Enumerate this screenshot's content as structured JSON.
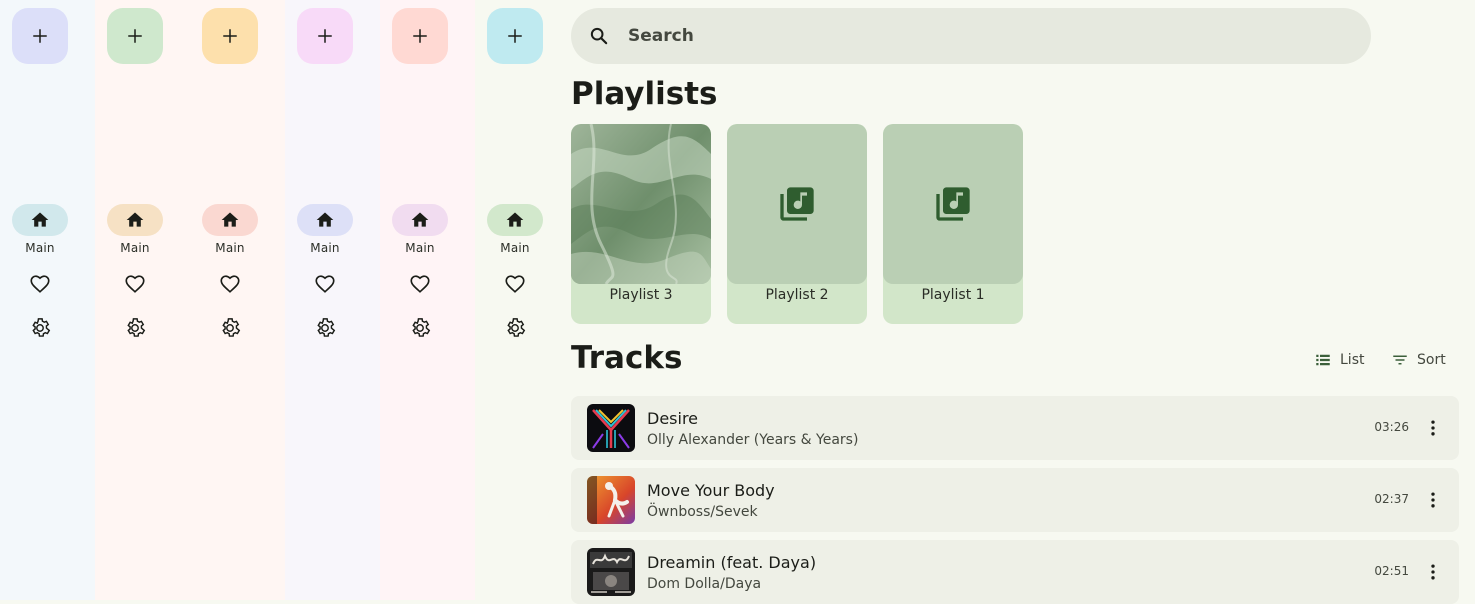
{
  "rails": [
    {
      "bg": "#f3f8fb",
      "fab": "#dcdff9",
      "pill": "#d1e8ec",
      "main_label": "Main"
    },
    {
      "bg": "#fff6f3",
      "fab": "#cfe8cd",
      "pill": "#f6e1c4",
      "main_label": "Main"
    },
    {
      "bg": "#fff6f3",
      "fab": "#fde0ac",
      "pill": "#fad8d1",
      "main_label": "Main"
    },
    {
      "bg": "#f8f6fb",
      "fab": "#f8daf8",
      "pill": "#dde0f7",
      "main_label": "Main"
    },
    {
      "bg": "#fff4f6",
      "fab": "#ffd9d3",
      "pill": "#f1dcf0",
      "main_label": "Main"
    },
    {
      "bg": "#f7f9f1",
      "fab": "#bfeaf0",
      "pill": "#d2e8cc",
      "main_label": "Main"
    }
  ],
  "search": {
    "placeholder": "Search"
  },
  "playlists": {
    "heading": "Playlists",
    "items": [
      {
        "label": "Playlist 3"
      },
      {
        "label": "Playlist 2"
      },
      {
        "label": "Playlist 1"
      }
    ]
  },
  "tracks": {
    "heading": "Tracks",
    "list_label": "List",
    "sort_label": "Sort",
    "items": [
      {
        "title": "Desire",
        "artist": "Olly Alexander (Years & Years)",
        "duration": "03:26"
      },
      {
        "title": "Move Your Body",
        "artist": "Öwnboss/Sevek",
        "duration": "02:37"
      },
      {
        "title": "Dreamin (feat. Daya)",
        "artist": "Dom Dolla/Daya",
        "duration": "02:51"
      }
    ]
  },
  "icons": {
    "fab": "add-icon",
    "nav_main": "home-icon",
    "nav_favorites": "heart-icon",
    "nav_settings": "gear-icon",
    "search": "search-icon",
    "playlist_placeholder": "library-music-icon",
    "list_view": "list-icon",
    "sort": "sort-icon",
    "track_menu": "more-vert-icon"
  }
}
